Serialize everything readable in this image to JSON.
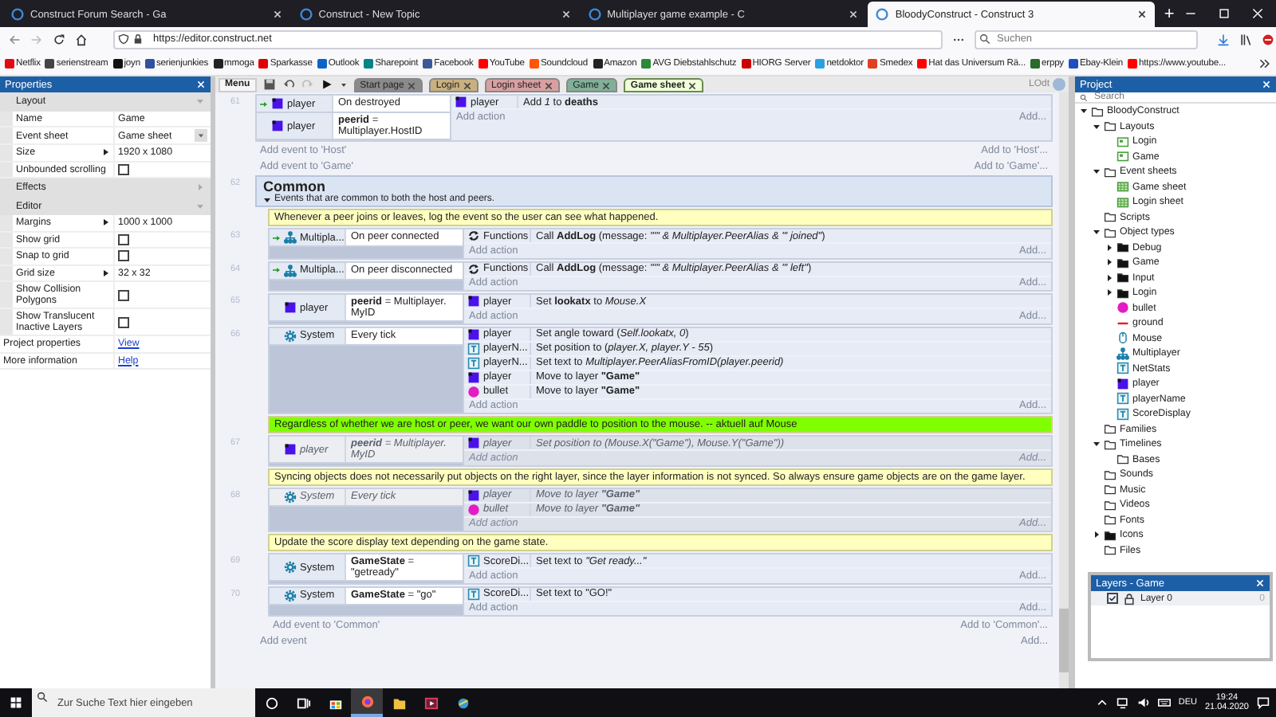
{
  "browser": {
    "tabs": [
      {
        "title": "Construct Forum Search - Ga",
        "selected": false
      },
      {
        "title": "Construct - New Topic",
        "selected": false
      },
      {
        "title": "Multiplayer game example - C",
        "selected": false
      },
      {
        "title": "BloodyConstruct - Construct 3",
        "selected": true
      }
    ],
    "new_tab": "+",
    "url": "https://editor.construct.net",
    "search": {
      "placeholder": "Suchen"
    },
    "bookmarks": [
      {
        "label": "Netflix",
        "color": "#e50914"
      },
      {
        "label": "serienstream",
        "color": "#444444"
      },
      {
        "label": "joyn",
        "color": "#111111"
      },
      {
        "label": "serienjunkies",
        "color": "#3050a0"
      },
      {
        "label": "mmoga",
        "color": "#222222"
      },
      {
        "label": "Sparkasse",
        "color": "#e00000"
      },
      {
        "label": "Outlook",
        "color": "#0a64c8"
      },
      {
        "label": "Sharepoint",
        "color": "#038387"
      },
      {
        "label": "Facebook",
        "color": "#3b5998"
      },
      {
        "label": "YouTube",
        "color": "#ff0000"
      },
      {
        "label": "Soundcloud",
        "color": "#ff5500"
      },
      {
        "label": "Amazon",
        "color": "#222222"
      },
      {
        "label": "AVG Diebstahlschutz",
        "color": "#2a8a3a"
      },
      {
        "label": "HIORG Server",
        "color": "#cc0000"
      },
      {
        "label": "netdoktor",
        "color": "#2aa0e0"
      },
      {
        "label": "Smedex",
        "color": "#e04020"
      },
      {
        "label": "Hat das Universum Rä...",
        "color": "#ff0000"
      },
      {
        "label": "erppy",
        "color": "#2a6a2a"
      },
      {
        "label": "Ebay-Klein",
        "color": "#2050c0"
      },
      {
        "label": "https://www.youtube...",
        "color": "#ff0000"
      }
    ]
  },
  "properties": {
    "title": "Properties",
    "rows": [
      {
        "kind": "section",
        "label": "Layout",
        "expanded": true
      },
      {
        "kind": "text",
        "label": "Name",
        "value": "Game"
      },
      {
        "kind": "dropdown",
        "label": "Event sheet",
        "value": "Game sheet"
      },
      {
        "kind": "expandable",
        "label": "Size",
        "value": "1920 x 1080"
      },
      {
        "kind": "check",
        "label": "Unbounded scrolling",
        "checked": false
      },
      {
        "kind": "section",
        "label": "Effects",
        "expanded": false
      },
      {
        "kind": "section",
        "label": "Editor",
        "expanded": true
      },
      {
        "kind": "expandable",
        "label": "Margins",
        "value": "1000 x 1000"
      },
      {
        "kind": "check",
        "label": "Show grid",
        "checked": false
      },
      {
        "kind": "check",
        "label": "Snap to grid",
        "checked": false
      },
      {
        "kind": "expandable",
        "label": "Grid size",
        "value": "32 x 32"
      },
      {
        "kind": "check",
        "label": "Show Collision Polygons",
        "checked": false
      },
      {
        "kind": "check",
        "label": "Show Translucent Inactive Layers",
        "checked": false
      },
      {
        "kind": "link",
        "label": "Project properties",
        "value": "View"
      },
      {
        "kind": "link",
        "label": "More information",
        "value": "Help"
      }
    ]
  },
  "toolbar": {
    "menu": "Menu",
    "user": "LOdt",
    "tabs": [
      {
        "label": "Start page",
        "color": "#8a8a8a",
        "selected": false
      },
      {
        "label": "Login",
        "color": "#c8b080",
        "selected": false
      },
      {
        "label": "Login sheet",
        "color": "#d8a0a0",
        "selected": false
      },
      {
        "label": "Game",
        "color": "#80b098",
        "selected": false
      },
      {
        "label": "Game sheet",
        "color": "#f0ffd8",
        "selected": true
      }
    ]
  },
  "sheet": {
    "rows": [
      {
        "kind": "event",
        "number": "61",
        "disabled": false,
        "add_action": "Add action",
        "add_more": "Add...",
        "conditions": [
          {
            "trigger": true,
            "kind": "sprite",
            "object": "player",
            "text": "On destroyed"
          },
          {
            "trigger": false,
            "kind": "sprite",
            "object": "player",
            "text": "**peerid** = Multiplayer.HostID"
          }
        ],
        "actions": [
          {
            "kind": "sprite",
            "object": "player",
            "text": "Add *1* to **deaths**"
          }
        ]
      },
      {
        "kind": "add",
        "label": "Add event to 'Host'",
        "more": "Add to 'Host'..."
      },
      {
        "kind": "add",
        "label": "Add event to 'Game'",
        "more": "Add to 'Game'..."
      },
      {
        "kind": "group",
        "number": "62",
        "title": "Common",
        "description": "Events that are common to both the host and peers.",
        "expanded": true,
        "children": [
          {
            "kind": "comment",
            "color": "#ffffc0",
            "text": "Whenever a peer joins or leaves, log the event so the user can see what happened."
          },
          {
            "kind": "event",
            "number": "63",
            "disabled": false,
            "add_action": "Add action",
            "add_more": "Add...",
            "conditions": [
              {
                "trigger": true,
                "kind": "multiplayer",
                "object": "Multipla...",
                "text": "On peer connected"
              }
            ],
            "actions": [
              {
                "kind": "functions",
                "object": "Functions",
                "text": "Call **AddLog** (message: *\"'\" & Multiplayer.PeerAlias & \"' joined\"*)"
              }
            ]
          },
          {
            "kind": "event",
            "number": "64",
            "disabled": false,
            "add_action": "Add action",
            "add_more": "Add...",
            "conditions": [
              {
                "trigger": true,
                "kind": "multiplayer",
                "object": "Multipla...",
                "text": "On peer disconnected"
              }
            ],
            "actions": [
              {
                "kind": "functions",
                "object": "Functions",
                "text": "Call **AddLog** (message: *\"'\" & Multiplayer.PeerAlias & \"' left\"*)"
              }
            ]
          },
          {
            "kind": "event",
            "number": "65",
            "disabled": false,
            "add_action": "Add action",
            "add_more": "Add...",
            "conditions": [
              {
                "trigger": false,
                "kind": "sprite",
                "object": "player",
                "text": "**peerid** = Multiplayer. MyID"
              }
            ],
            "actions": [
              {
                "kind": "sprite",
                "object": "player",
                "text": "Set **lookatx** to *Mouse.X*"
              }
            ]
          },
          {
            "kind": "event",
            "number": "66",
            "disabled": false,
            "add_action": "Add action",
            "add_more": "Add...",
            "conditions": [
              {
                "trigger": false,
                "kind": "system",
                "object": "System",
                "text": "Every tick"
              }
            ],
            "actions": [
              {
                "kind": "sprite",
                "object": "player",
                "text": "Set angle toward (*Self.lookatx, 0*)"
              },
              {
                "kind": "text",
                "object": "playerN...",
                "text": "Set position to (*player.X, player.Y - 55*)"
              },
              {
                "kind": "text",
                "object": "playerN...",
                "text": "Set text to *Multiplayer.PeerAliasFromID(player.peerid)*"
              },
              {
                "kind": "sprite",
                "object": "player",
                "text": "Move to layer **\"Game\"**"
              },
              {
                "kind": "ball",
                "object": "bullet",
                "text": "Move to layer **\"Game\"**"
              }
            ]
          },
          {
            "kind": "comment",
            "color": "#80ff00",
            "text": "Regardless of whether we are host or peer, we want our own paddle to position to the mouse.     -- aktuell auf Mouse"
          },
          {
            "kind": "event",
            "number": "67",
            "disabled": true,
            "add_action": "Add action",
            "add_more": "Add...",
            "conditions": [
              {
                "trigger": false,
                "kind": "sprite",
                "object": "player",
                "text": "**peerid** = Multiplayer. MyID"
              }
            ],
            "actions": [
              {
                "kind": "sprite",
                "object": "player",
                "text": "Set position to (*Mouse.X(\"Game\"), Mouse.Y(\"Game\")*)"
              }
            ]
          },
          {
            "kind": "comment",
            "color": "#ffffc0",
            "text": "Syncing objects does not necessarily put objects on the right layer, since the layer information is not synced. So always ensure game objects are on the game layer."
          },
          {
            "kind": "event",
            "number": "68",
            "disabled": true,
            "add_action": "Add action",
            "add_more": "Add...",
            "conditions": [
              {
                "trigger": false,
                "kind": "system",
                "object": "System",
                "text": "Every tick"
              }
            ],
            "actions": [
              {
                "kind": "sprite",
                "object": "player",
                "text": "Move to layer **\"Game\"**"
              },
              {
                "kind": "ball",
                "object": "bullet",
                "text": "Move to layer **\"Game\"**"
              }
            ]
          },
          {
            "kind": "comment",
            "color": "#ffffc0",
            "text": "Update the score display text depending on the game state."
          },
          {
            "kind": "event",
            "number": "69",
            "disabled": false,
            "add_action": "Add action",
            "add_more": "Add...",
            "conditions": [
              {
                "trigger": false,
                "kind": "system",
                "object": "System",
                "text": "**GameState** = \"getready\""
              }
            ],
            "actions": [
              {
                "kind": "text",
                "object": "ScoreDi...",
                "text": "Set text to *\"Get ready...\"*"
              }
            ]
          },
          {
            "kind": "event",
            "number": "70",
            "disabled": false,
            "add_action": "Add action",
            "add_more": "Add...",
            "conditions": [
              {
                "trigger": false,
                "kind": "system",
                "object": "System",
                "text": "**GameState** = \"go\""
              }
            ],
            "actions": [
              {
                "kind": "text",
                "object": "ScoreDi...",
                "text": "Set text to \"GO!\""
              }
            ]
          },
          {
            "kind": "add",
            "label": "Add event to 'Common'",
            "more": "Add to 'Common'..."
          }
        ]
      },
      {
        "kind": "add",
        "label": "Add event",
        "more": "Add..."
      }
    ]
  },
  "project": {
    "title": "Project",
    "search": {
      "placeholder": "Search"
    },
    "tree": [
      {
        "label": "BloodyConstruct",
        "kind": "folder",
        "expanded": true,
        "children": [
          {
            "label": "Layouts",
            "kind": "folder",
            "expanded": true,
            "children": [
              {
                "label": "Login",
                "kind": "layout"
              },
              {
                "label": "Game",
                "kind": "layout"
              }
            ]
          },
          {
            "label": "Event sheets",
            "kind": "folder",
            "expanded": true,
            "children": [
              {
                "label": "Game sheet",
                "kind": "sheet"
              },
              {
                "label": "Login sheet",
                "kind": "sheet"
              }
            ]
          },
          {
            "label": "Scripts",
            "kind": "folder"
          },
          {
            "label": "Object types",
            "kind": "folder",
            "expanded": true,
            "children": [
              {
                "label": "Debug",
                "kind": "folder",
                "expanded": false
              },
              {
                "label": "Game",
                "kind": "folder",
                "expanded": false
              },
              {
                "label": "Input",
                "kind": "folder",
                "expanded": false
              },
              {
                "label": "Login",
                "kind": "folder",
                "expanded": false
              },
              {
                "label": "bullet",
                "kind": "ball"
              },
              {
                "label": "ground",
                "kind": "line"
              },
              {
                "label": "Mouse",
                "kind": "mouse"
              },
              {
                "label": "Multiplayer",
                "kind": "multiplayer"
              },
              {
                "label": "NetStats",
                "kind": "text"
              },
              {
                "label": "player",
                "kind": "sprite"
              },
              {
                "label": "playerName",
                "kind": "text"
              },
              {
                "label": "ScoreDisplay",
                "kind": "text"
              }
            ]
          },
          {
            "label": "Families",
            "kind": "folder"
          },
          {
            "label": "Timelines",
            "kind": "folder",
            "expanded": true,
            "children": [
              {
                "label": "Bases",
                "kind": "folder"
              }
            ]
          },
          {
            "label": "Sounds",
            "kind": "folder"
          },
          {
            "label": "Music",
            "kind": "folder"
          },
          {
            "label": "Videos",
            "kind": "folder"
          },
          {
            "label": "Fonts",
            "kind": "folder"
          },
          {
            "label": "Icons",
            "kind": "folder",
            "expanded": false
          },
          {
            "label": "Files",
            "kind": "folder"
          }
        ]
      }
    ]
  },
  "layers": {
    "title": "Layers - Game",
    "layers": [
      {
        "name": "Layer 0",
        "visible": true,
        "index": "0"
      }
    ]
  },
  "taskbar": {
    "search": {
      "placeholder": "Zur Suche Text hier eingeben"
    },
    "language": "DEU",
    "time": "19:24",
    "date": "21.04.2020"
  }
}
